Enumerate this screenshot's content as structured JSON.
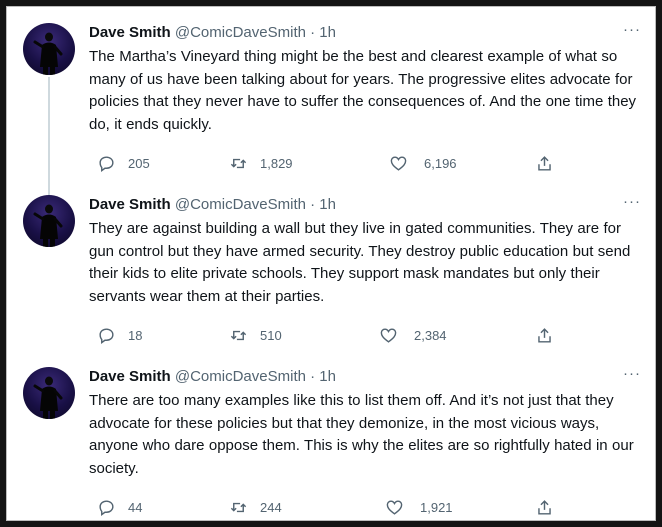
{
  "tweets": [
    {
      "name": "Dave Smith",
      "handle": "@ComicDaveSmith",
      "time": "· 1h",
      "text": "The Martha’s Vineyard thing might be the best and clearest example of what so many of us have been talking about for years. The progressive elites advocate for policies that they never have to suffer the consequences of. And the one time they do, it ends quickly.",
      "replies": "205",
      "retweets": "1,829",
      "likes": "6,196"
    },
    {
      "name": "Dave Smith",
      "handle": "@ComicDaveSmith",
      "time": "· 1h",
      "text": "They are against building a wall but they live in gated communities. They are for gun control but they have armed security. They destroy public education but send their kids to elite private schools. They support mask mandates but only their servants wear them at their parties.",
      "replies": "18",
      "retweets": "510",
      "likes": "2,384"
    },
    {
      "name": "Dave Smith",
      "handle": "@ComicDaveSmith",
      "time": "· 1h",
      "text": "There are too many examples like this to list them off. And it’s not just that they advocate for these policies but that they demonize, in the most vicious ways, anyone who dare oppose them. This is why the elites are so rightfully hated in our society.",
      "replies": "44",
      "retweets": "244",
      "likes": "1,921"
    }
  ],
  "more_label": "···"
}
